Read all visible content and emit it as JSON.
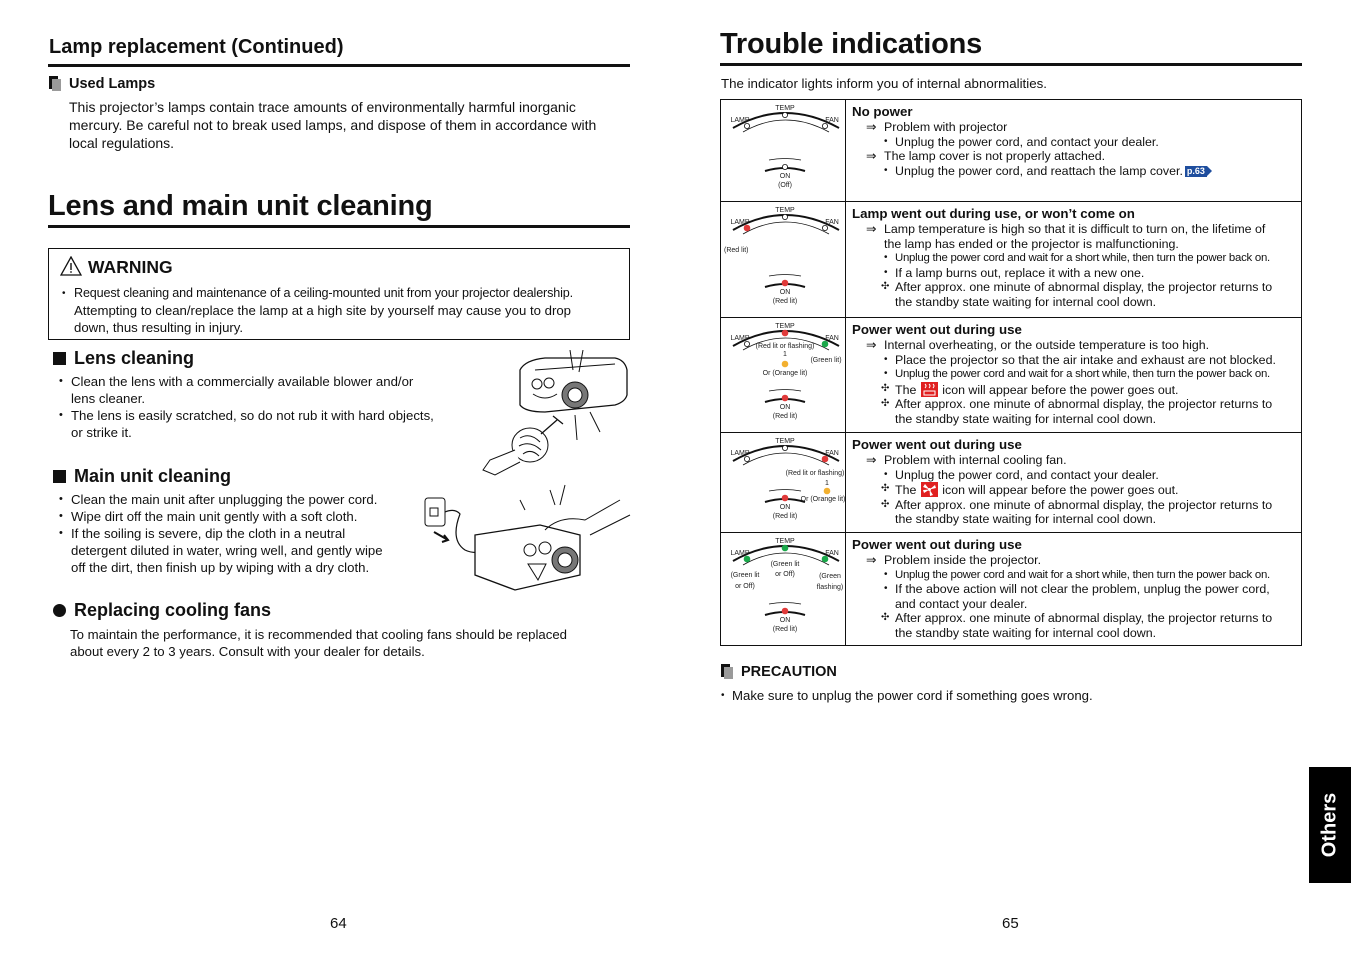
{
  "left_page": {
    "section1_title": "Lamp replacement (Continued)",
    "used_lamps": {
      "heading": "Used Lamps",
      "text_lines": [
        "This projector’s lamps contain trace amounts of environmentally harmful inorganic",
        "mercury. Be careful not to break used lamps, and dispose of them in accordance with",
        "local regulations."
      ]
    },
    "section2_title": "Lens and main unit cleaning",
    "warning": {
      "label": "WARNING",
      "lines": [
        "Request cleaning and maintenance of a ceiling-mounted unit from your projector dealership.",
        "Attempting to clean/replace the lamp at a high site by yourself may cause you to drop",
        "down, thus resulting in injury."
      ]
    },
    "lens_cleaning": {
      "heading": "Lens cleaning",
      "bullets": [
        [
          "Clean the lens with a commercially available blower and/or",
          "lens cleaner."
        ],
        [
          "The lens is easily scratched, so do not rub it with hard objects,",
          "or strike it."
        ]
      ]
    },
    "main_unit_cleaning": {
      "heading": "Main unit cleaning",
      "bullets": [
        [
          "Clean the main unit after unplugging the power cord."
        ],
        [
          "Wipe dirt off the main unit gently with a soft cloth."
        ],
        [
          "If the soiling is severe, dip the cloth in a neutral",
          "detergent diluted in water, wring well, and gently wipe",
          "off the dirt, then finish up by wiping with a dry cloth."
        ]
      ]
    },
    "cooling_fans": {
      "heading": "Replacing cooling fans",
      "text_lines": [
        "To maintain the performance, it is recommended that cooling fans should be replaced",
        "about every 2 to 3 years. Consult with your dealer for details."
      ]
    },
    "page_number": "64"
  },
  "right_page": {
    "title": "Trouble indications",
    "intro": "The indicator lights inform you of internal abnormalities.",
    "panel_labels": {
      "temp": "TEMP",
      "lamp": "LAMP",
      "fan": "FAN",
      "on": "ON"
    },
    "colors": {
      "red": "#e03a3a",
      "green": "#1aa84a",
      "orange": "#f2b030",
      "ref_blue": "#1f4e9e"
    },
    "rows": [
      {
        "title": "No power",
        "indicators": {
          "lamp": "off",
          "temp": "off",
          "fan": "off",
          "on": "off"
        },
        "notes": {
          "on": "(Off)"
        },
        "lines": [
          {
            "type": "arrow",
            "text": "Problem with projector"
          },
          {
            "type": "dot",
            "text": "Unplug the power cord, and contact your dealer."
          },
          {
            "type": "arrow",
            "text": "The lamp cover is not properly attached."
          },
          {
            "type": "dot",
            "text": "Unplug the power cord, and reattach the lamp cover.",
            "ref": "p.63"
          }
        ]
      },
      {
        "title": "Lamp went out during use, or won’t come on",
        "indicators": {
          "lamp": "red",
          "temp": "off",
          "fan": "off",
          "on": "red"
        },
        "notes": {
          "lamp": "(Red lit)",
          "on": "(Red lit)"
        },
        "lines": [
          {
            "type": "arrow",
            "text": "Lamp temperature is high so that it is difficult to turn on, the lifetime of"
          },
          {
            "type": "cont",
            "text": "the lamp has ended or the projector is malfunctioning."
          },
          {
            "type": "dot",
            "text": "Unplug the power cord and wait for a short while, then turn the power back on.",
            "narrow": true
          },
          {
            "type": "dot",
            "text": "If a lamp burns out, replace it with a new one."
          },
          {
            "type": "star",
            "text": "After approx. one minute of abnormal display, the projector returns to"
          },
          {
            "type": "cont2",
            "text": "the standby state waiting for internal cool down."
          }
        ]
      },
      {
        "title": "Power went out during use",
        "indicators": {
          "lamp": "off",
          "temp": "red",
          "fan": "green",
          "on": "red",
          "alt": "orange"
        },
        "notes": {
          "temp": "(Red lit or flashing)",
          "fan": "(Green lit)",
          "alt": "Or (Orange lit)",
          "on": "(Red lit)"
        },
        "lines": [
          {
            "type": "arrow",
            "text": "Internal overheating, or the outside temperature is too high."
          },
          {
            "type": "dot",
            "text": "Place the projector so that the air intake and exhaust are not blocked."
          },
          {
            "type": "dot",
            "text": "Unplug the power cord and wait for a short while, then turn the power back on.",
            "narrow": true
          },
          {
            "type": "star",
            "text_before": "The",
            "icon": "overheat-icon",
            "text_after": "icon will appear before the power goes out."
          },
          {
            "type": "star",
            "text": "After approx. one minute of abnormal display, the projector returns to"
          },
          {
            "type": "cont2",
            "text": "the standby state waiting for internal cool down."
          }
        ]
      },
      {
        "title": "Power went out during use",
        "indicators": {
          "lamp": "off",
          "temp": "off",
          "fan": "red",
          "on": "red",
          "alt": "orange"
        },
        "notes": {
          "fan": "(Red lit or flashing)",
          "alt": "Or (Orange lit)",
          "on": "(Red lit)"
        },
        "lines": [
          {
            "type": "arrow",
            "text": "Problem with internal cooling fan."
          },
          {
            "type": "dot",
            "text": "Unplug the power cord, and contact your dealer."
          },
          {
            "type": "star",
            "text_before": "The",
            "icon": "fan-warning-icon",
            "text_after": "icon will appear before the power goes out."
          },
          {
            "type": "star",
            "text": "After approx. one minute of abnormal display, the projector returns to"
          },
          {
            "type": "cont2",
            "text": "the standby state waiting for internal cool down."
          }
        ]
      },
      {
        "title": "Power went out during use",
        "indicators": {
          "lamp": "green",
          "temp": "green",
          "fan": "green",
          "on": "red"
        },
        "notes": {
          "lamp": "(Green lit or Off)",
          "temp": "(Green lit or Off)",
          "fan": "(Green flashing)",
          "on": "(Red lit)"
        },
        "lines": [
          {
            "type": "arrow",
            "text": "Problem inside the projector."
          },
          {
            "type": "dot",
            "text": "Unplug the power cord and wait for a short while, then turn the power back on.",
            "narrow": true
          },
          {
            "type": "dot",
            "text": "If the above action will not clear the problem, unplug  the power cord,"
          },
          {
            "type": "cont3",
            "text": "and contact your dealer."
          },
          {
            "type": "star",
            "text": "After approx. one minute of abnormal display, the projector returns to"
          },
          {
            "type": "cont2",
            "text": "the standby state waiting for internal cool down."
          }
        ]
      }
    ],
    "precaution": {
      "heading": "PRECAUTION",
      "bullet": "Make sure to unplug the power cord if something goes wrong."
    },
    "side_tab": "Others",
    "page_number": "65"
  }
}
